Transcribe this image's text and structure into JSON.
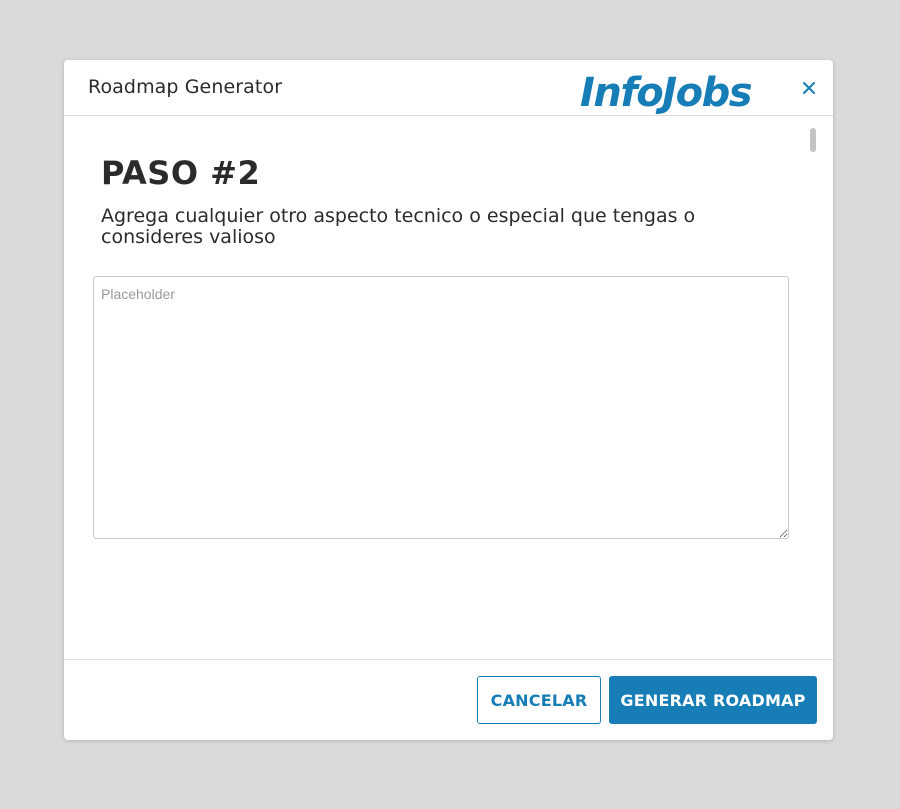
{
  "modal": {
    "title": "Roadmap Generator",
    "brand": "InfoJobs",
    "close_icon": "close-icon",
    "accent_color": "#167db7"
  },
  "step": {
    "title": "PASO #2",
    "description": "Agrega cualquier otro aspecto tecnico o especial que tengas o consideres valioso"
  },
  "details_input": {
    "value": "",
    "placeholder": "Placeholder"
  },
  "footer": {
    "cancel_label": "CANCELAR",
    "generate_label": "GENERAR ROADMAP"
  }
}
